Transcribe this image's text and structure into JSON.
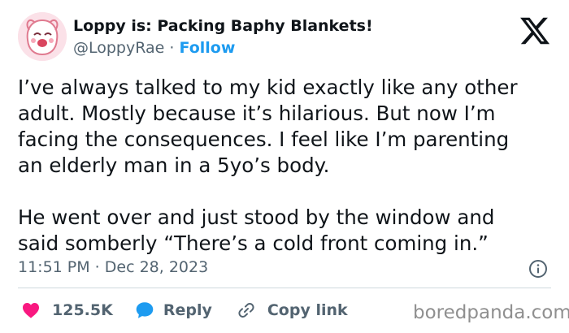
{
  "author": {
    "display_name": "Loppy is: Packing Baphy Blankets!",
    "handle": "@LoppyRae",
    "separator": "·",
    "follow_label": "Follow",
    "avatar_icon": "cartoon-face-avatar"
  },
  "logo_icon": "x-logo",
  "tweet": {
    "paragraphs": [
      {
        "lines": [
          "I’ve always talked to my kid exactly like any other",
          "adult. Mostly because it’s hilarious. But now I’m",
          "facing the consequences. I feel like I’m parenting",
          "an elderly man in a 5yo’s body."
        ]
      },
      {
        "lines": [
          "He went over and just stood by the window and",
          "said somberly “There’s a cold front coming in.”"
        ]
      }
    ],
    "time": "11:51 PM · Dec 28, 2023",
    "info_icon": "info-icon"
  },
  "actions": {
    "like_count": "125.5K",
    "reply_label": "Reply",
    "copy_label": "Copy link",
    "like_icon": "heart-icon",
    "reply_icon": "speech-bubble-icon",
    "copy_icon": "link-icon"
  },
  "watermark": "boredpanda.com",
  "colors": {
    "accent": "#1d9bf0",
    "like": "#f91880",
    "secondary_text": "#536471",
    "primary_text": "#0f1419"
  }
}
